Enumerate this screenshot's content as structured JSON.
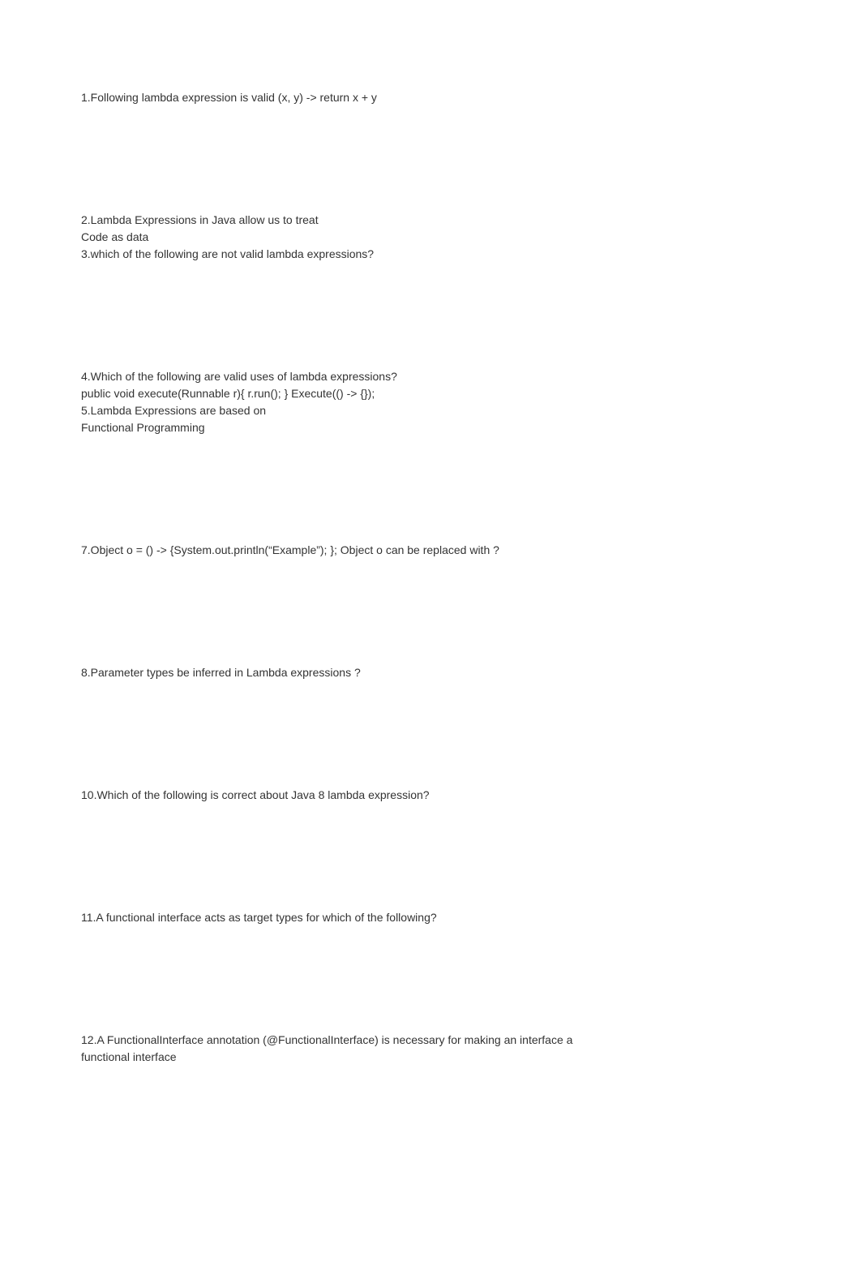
{
  "questions": {
    "q1": {
      "text": "1.Following lambda expression is valid (x, y) -> return x + y"
    },
    "q2": {
      "line1": "2.Lambda Expressions in Java allow us to treat",
      "line2": "Code as data"
    },
    "q3": {
      "text": "3.which of the following are not valid lambda expressions?"
    },
    "q4": {
      "line1": "4.Which of the following are valid uses of lambda expressions?",
      "line2": "public void execute(Runnable r){ r.run(); } Execute(() -> {});"
    },
    "q5": {
      "line1": "5.Lambda Expressions are based on",
      "line2": "Functional Programming"
    },
    "q7": {
      "text": "7.Object o = () -> {System.out.println(“Example”); }; Object o can be replaced with ?"
    },
    "q8": {
      "text": "8.Parameter types be inferred in Lambda expressions ?"
    },
    "q10": {
      "text": "10.Which of the following is correct about Java 8 lambda expression?"
    },
    "q11": {
      "text": "11.A functional interface acts as target types for which of the following?"
    },
    "q12": {
      "line1": "12.A FunctionalInterface annotation (@FunctionalInterface) is necessary for making an interface a",
      "line2": "functional interface"
    }
  }
}
